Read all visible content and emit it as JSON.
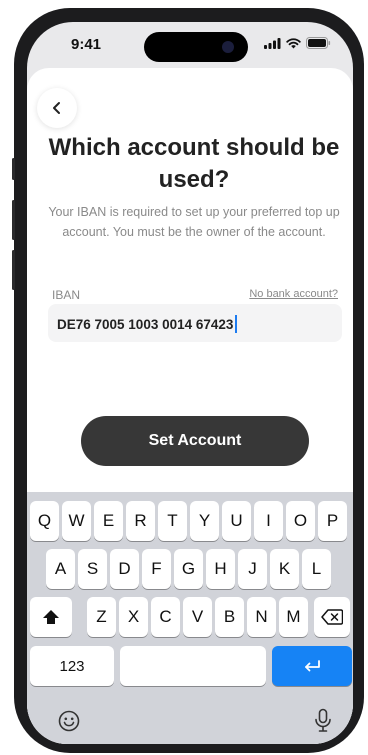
{
  "status_bar": {
    "time": "9:41"
  },
  "header": {
    "back_icon": "chevron-left-icon"
  },
  "page": {
    "title": "Which account should be used?",
    "description": "Your IBAN is required to set up your preferred top up account. You must be the owner of the account."
  },
  "form": {
    "iban_label": "IBAN",
    "no_bank_link": "No bank account?",
    "iban_value": "DE76 7005 1003 0014 67423"
  },
  "cta": {
    "label": "Set Account"
  },
  "keyboard": {
    "row1": [
      "Q",
      "W",
      "E",
      "R",
      "T",
      "Y",
      "U",
      "I",
      "O",
      "P"
    ],
    "row2": [
      "A",
      "S",
      "D",
      "F",
      "G",
      "H",
      "J",
      "K",
      "L"
    ],
    "row3": [
      "Z",
      "X",
      "C",
      "V",
      "B",
      "N",
      "M"
    ],
    "numbers_key": "123",
    "shift_icon": "shift-icon",
    "delete_icon": "delete-icon",
    "return_icon": "return-icon",
    "emoji_icon": "emoji-icon",
    "mic_icon": "microphone-icon",
    "return_color": "#1683f5"
  }
}
